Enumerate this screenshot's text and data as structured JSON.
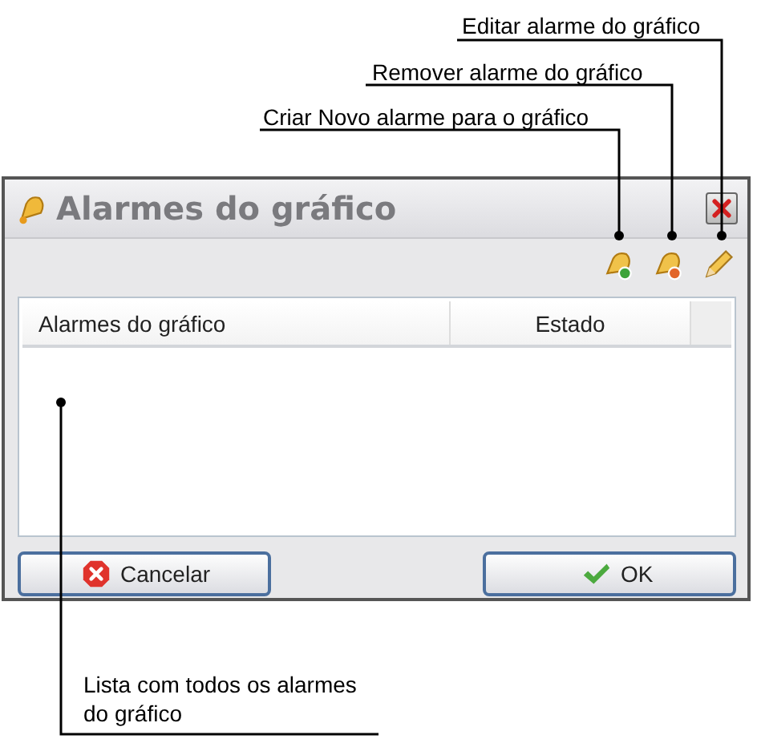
{
  "annotations": [
    {
      "text": "Editar alarme do gráfico"
    },
    {
      "text": "Remover alarme do gráfico"
    },
    {
      "text": "Criar Novo alarme para o gráfico"
    },
    {
      "text": "Lista com todos os alarmes do gráfico"
    }
  ],
  "window": {
    "title": "Alarmes do gráfico"
  },
  "table": {
    "columns": [
      "Alarmes do gráfico",
      "Estado"
    ]
  },
  "buttons": [
    {
      "label": "Cancelar",
      "kind": "cancel"
    },
    {
      "label": "OK",
      "kind": "ok"
    }
  ]
}
